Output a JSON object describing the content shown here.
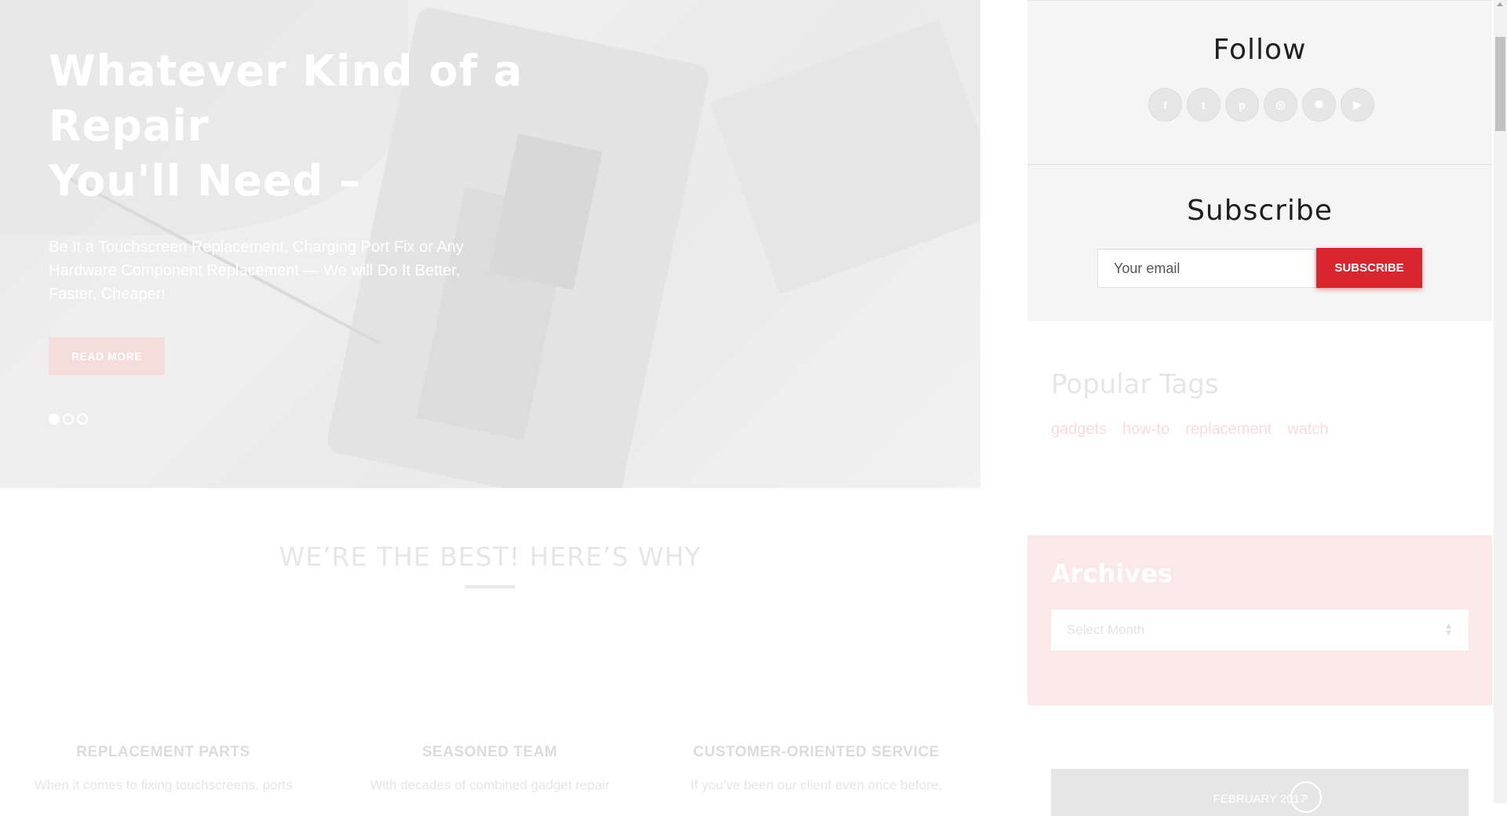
{
  "hero": {
    "title_lines": [
      "Whatever Kind of a",
      "Repair",
      "You'll Need –"
    ],
    "text": "Be It a Touchscreen Replacement, Charging Port Fix or Any Hardware Component Replacement — We will Do It Better, Faster, Cheaper!",
    "button_label": "READ MORE",
    "slides_count": 3,
    "active_slide": 1
  },
  "features": {
    "heading": "WE’RE THE BEST! HERE’S WHY",
    "items": [
      {
        "title": "REPLACEMENT PARTS",
        "text": "When it comes to fixing touchscreens, ports"
      },
      {
        "title": "SEASONED TEAM",
        "text": "With decades of combined gadget repair"
      },
      {
        "title": "CUSTOMER-ORIENTED SERVICE",
        "text": "If you’ve been our client even once before,"
      }
    ]
  },
  "sidebar": {
    "follow": {
      "title": "Follow",
      "icons": [
        "facebook-icon",
        "twitter-icon",
        "pinterest-icon",
        "instagram-icon",
        "dribbble-icon",
        "youtube-icon"
      ],
      "glyphs": [
        "f",
        "t",
        "p",
        "◎",
        "✺",
        "▶"
      ]
    },
    "subscribe": {
      "title": "Subscribe",
      "placeholder": "Your email",
      "button_label": "SUBSCRIBE"
    },
    "tags": {
      "title": "Popular Tags",
      "items": [
        "gadgets",
        "how-to",
        "replacement",
        "watch"
      ]
    },
    "archives": {
      "title": "Archives",
      "select_value": "Select Month"
    },
    "calendar": {
      "month_label": "FEBRUARY 2017",
      "next_glyph": "›"
    }
  },
  "colors": {
    "accent": "#d9262e",
    "hero_button": "#f7dcdc",
    "archives_bg": "#fbe8e8"
  }
}
